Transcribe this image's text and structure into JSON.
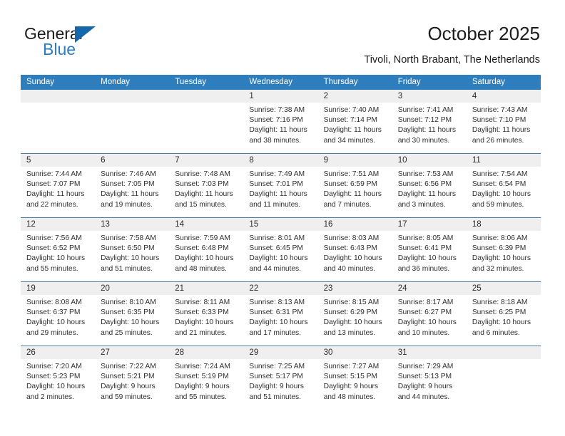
{
  "brand": {
    "word_general": "General",
    "word_blue": "Blue",
    "accent_color": "#1567ab"
  },
  "header": {
    "title": "October 2025",
    "subtitle": "Tivoli, North Brabant, The Netherlands",
    "header_bg_color": "#2e7ebd"
  },
  "weekdays": [
    "Sunday",
    "Monday",
    "Tuesday",
    "Wednesday",
    "Thursday",
    "Friday",
    "Saturday"
  ],
  "weeks": [
    [
      {
        "date": "",
        "lines": []
      },
      {
        "date": "",
        "lines": []
      },
      {
        "date": "",
        "lines": []
      },
      {
        "date": "1",
        "lines": [
          "Sunrise: 7:38 AM",
          "Sunset: 7:16 PM",
          "Daylight: 11 hours",
          "and 38 minutes."
        ]
      },
      {
        "date": "2",
        "lines": [
          "Sunrise: 7:40 AM",
          "Sunset: 7:14 PM",
          "Daylight: 11 hours",
          "and 34 minutes."
        ]
      },
      {
        "date": "3",
        "lines": [
          "Sunrise: 7:41 AM",
          "Sunset: 7:12 PM",
          "Daylight: 11 hours",
          "and 30 minutes."
        ]
      },
      {
        "date": "4",
        "lines": [
          "Sunrise: 7:43 AM",
          "Sunset: 7:10 PM",
          "Daylight: 11 hours",
          "and 26 minutes."
        ]
      }
    ],
    [
      {
        "date": "5",
        "lines": [
          "Sunrise: 7:44 AM",
          "Sunset: 7:07 PM",
          "Daylight: 11 hours",
          "and 22 minutes."
        ]
      },
      {
        "date": "6",
        "lines": [
          "Sunrise: 7:46 AM",
          "Sunset: 7:05 PM",
          "Daylight: 11 hours",
          "and 19 minutes."
        ]
      },
      {
        "date": "7",
        "lines": [
          "Sunrise: 7:48 AM",
          "Sunset: 7:03 PM",
          "Daylight: 11 hours",
          "and 15 minutes."
        ]
      },
      {
        "date": "8",
        "lines": [
          "Sunrise: 7:49 AM",
          "Sunset: 7:01 PM",
          "Daylight: 11 hours",
          "and 11 minutes."
        ]
      },
      {
        "date": "9",
        "lines": [
          "Sunrise: 7:51 AM",
          "Sunset: 6:59 PM",
          "Daylight: 11 hours",
          "and 7 minutes."
        ]
      },
      {
        "date": "10",
        "lines": [
          "Sunrise: 7:53 AM",
          "Sunset: 6:56 PM",
          "Daylight: 11 hours",
          "and 3 minutes."
        ]
      },
      {
        "date": "11",
        "lines": [
          "Sunrise: 7:54 AM",
          "Sunset: 6:54 PM",
          "Daylight: 10 hours",
          "and 59 minutes."
        ]
      }
    ],
    [
      {
        "date": "12",
        "lines": [
          "Sunrise: 7:56 AM",
          "Sunset: 6:52 PM",
          "Daylight: 10 hours",
          "and 55 minutes."
        ]
      },
      {
        "date": "13",
        "lines": [
          "Sunrise: 7:58 AM",
          "Sunset: 6:50 PM",
          "Daylight: 10 hours",
          "and 51 minutes."
        ]
      },
      {
        "date": "14",
        "lines": [
          "Sunrise: 7:59 AM",
          "Sunset: 6:48 PM",
          "Daylight: 10 hours",
          "and 48 minutes."
        ]
      },
      {
        "date": "15",
        "lines": [
          "Sunrise: 8:01 AM",
          "Sunset: 6:45 PM",
          "Daylight: 10 hours",
          "and 44 minutes."
        ]
      },
      {
        "date": "16",
        "lines": [
          "Sunrise: 8:03 AM",
          "Sunset: 6:43 PM",
          "Daylight: 10 hours",
          "and 40 minutes."
        ]
      },
      {
        "date": "17",
        "lines": [
          "Sunrise: 8:05 AM",
          "Sunset: 6:41 PM",
          "Daylight: 10 hours",
          "and 36 minutes."
        ]
      },
      {
        "date": "18",
        "lines": [
          "Sunrise: 8:06 AM",
          "Sunset: 6:39 PM",
          "Daylight: 10 hours",
          "and 32 minutes."
        ]
      }
    ],
    [
      {
        "date": "19",
        "lines": [
          "Sunrise: 8:08 AM",
          "Sunset: 6:37 PM",
          "Daylight: 10 hours",
          "and 29 minutes."
        ]
      },
      {
        "date": "20",
        "lines": [
          "Sunrise: 8:10 AM",
          "Sunset: 6:35 PM",
          "Daylight: 10 hours",
          "and 25 minutes."
        ]
      },
      {
        "date": "21",
        "lines": [
          "Sunrise: 8:11 AM",
          "Sunset: 6:33 PM",
          "Daylight: 10 hours",
          "and 21 minutes."
        ]
      },
      {
        "date": "22",
        "lines": [
          "Sunrise: 8:13 AM",
          "Sunset: 6:31 PM",
          "Daylight: 10 hours",
          "and 17 minutes."
        ]
      },
      {
        "date": "23",
        "lines": [
          "Sunrise: 8:15 AM",
          "Sunset: 6:29 PM",
          "Daylight: 10 hours",
          "and 13 minutes."
        ]
      },
      {
        "date": "24",
        "lines": [
          "Sunrise: 8:17 AM",
          "Sunset: 6:27 PM",
          "Daylight: 10 hours",
          "and 10 minutes."
        ]
      },
      {
        "date": "25",
        "lines": [
          "Sunrise: 8:18 AM",
          "Sunset: 6:25 PM",
          "Daylight: 10 hours",
          "and 6 minutes."
        ]
      }
    ],
    [
      {
        "date": "26",
        "lines": [
          "Sunrise: 7:20 AM",
          "Sunset: 5:23 PM",
          "Daylight: 10 hours",
          "and 2 minutes."
        ]
      },
      {
        "date": "27",
        "lines": [
          "Sunrise: 7:22 AM",
          "Sunset: 5:21 PM",
          "Daylight: 9 hours",
          "and 59 minutes."
        ]
      },
      {
        "date": "28",
        "lines": [
          "Sunrise: 7:24 AM",
          "Sunset: 5:19 PM",
          "Daylight: 9 hours",
          "and 55 minutes."
        ]
      },
      {
        "date": "29",
        "lines": [
          "Sunrise: 7:25 AM",
          "Sunset: 5:17 PM",
          "Daylight: 9 hours",
          "and 51 minutes."
        ]
      },
      {
        "date": "30",
        "lines": [
          "Sunrise: 7:27 AM",
          "Sunset: 5:15 PM",
          "Daylight: 9 hours",
          "and 48 minutes."
        ]
      },
      {
        "date": "31",
        "lines": [
          "Sunrise: 7:29 AM",
          "Sunset: 5:13 PM",
          "Daylight: 9 hours",
          "and 44 minutes."
        ]
      },
      {
        "date": "",
        "lines": []
      }
    ]
  ]
}
